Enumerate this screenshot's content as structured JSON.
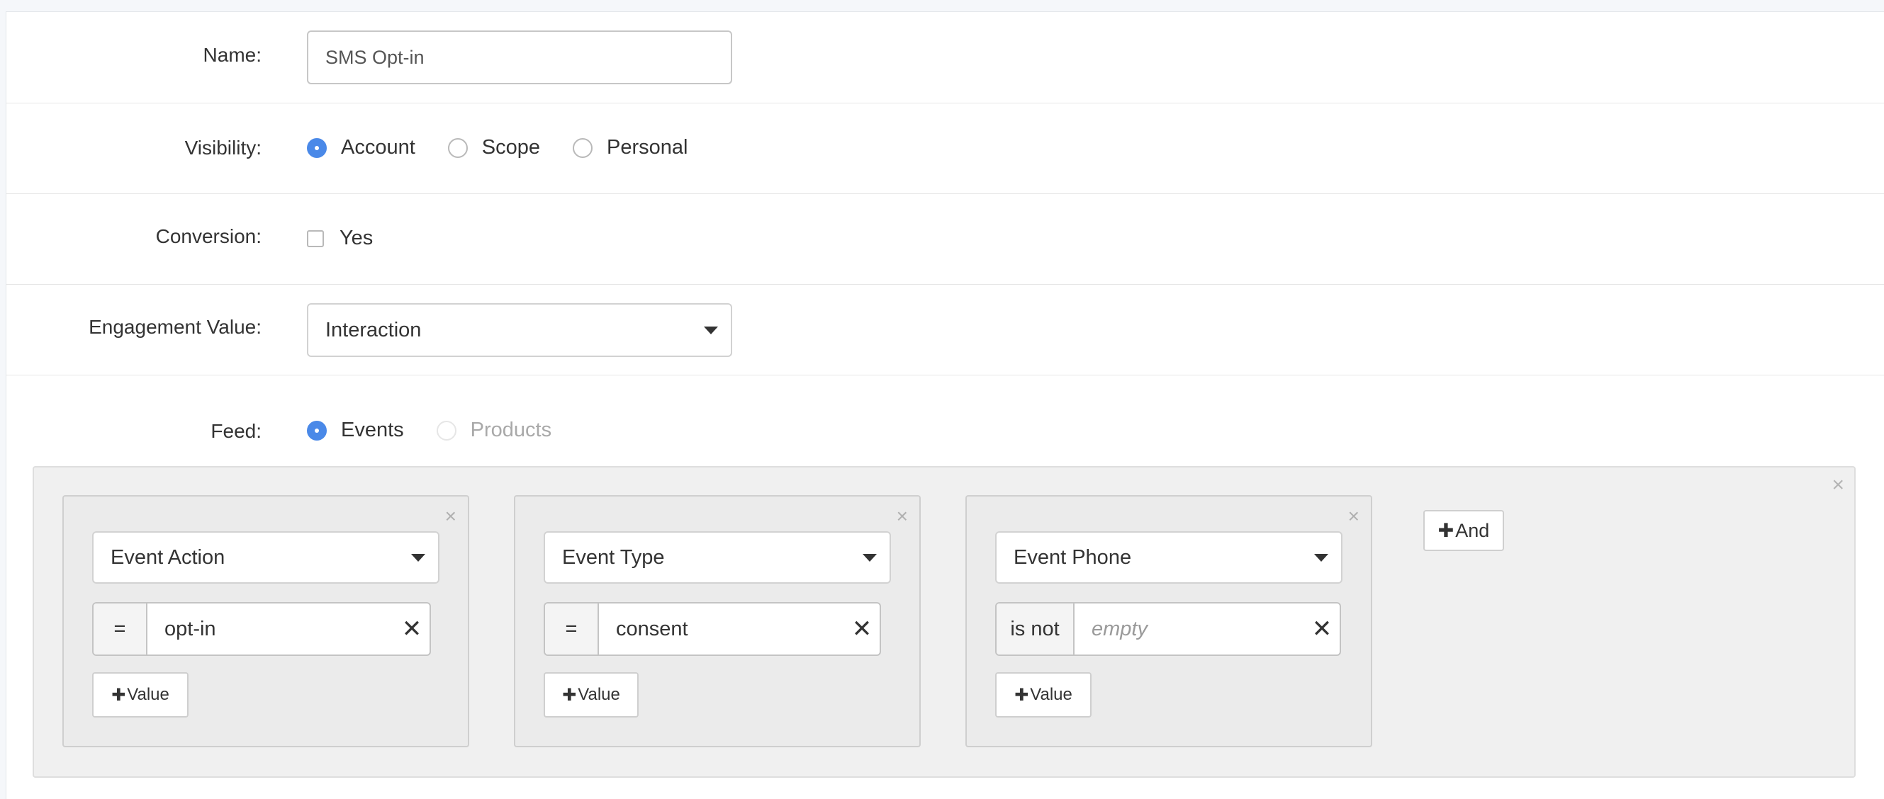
{
  "form": {
    "name": {
      "label": "Name:",
      "value": "SMS Opt-in"
    },
    "visibility": {
      "label": "Visibility:",
      "options": [
        {
          "label": "Account",
          "selected": true
        },
        {
          "label": "Scope",
          "selected": false
        },
        {
          "label": "Personal",
          "selected": false
        }
      ]
    },
    "conversion": {
      "label": "Conversion:",
      "checkbox_label": "Yes",
      "checked": false
    },
    "engagement": {
      "label": "Engagement Value:",
      "selected": "Interaction"
    },
    "feed": {
      "label": "Feed:",
      "options": [
        {
          "label": "Events",
          "selected": true,
          "disabled": false
        },
        {
          "label": "Products",
          "selected": false,
          "disabled": true
        }
      ]
    }
  },
  "builder": {
    "close_symbol": "×",
    "and_button": {
      "plus": "✚",
      "label": "And"
    },
    "conditions": [
      {
        "field": "Event Action",
        "operator": "=",
        "value": "opt-in",
        "placeholder": "",
        "add_value": "Value"
      },
      {
        "field": "Event Type",
        "operator": "=",
        "value": "consent",
        "placeholder": "",
        "add_value": "Value"
      },
      {
        "field": "Event Phone",
        "operator": "is not",
        "value": "",
        "placeholder": "empty",
        "add_value": "Value"
      }
    ],
    "clear_symbol": "✕",
    "plus_symbol": "✚"
  },
  "colors": {
    "accent": "#4a89e8",
    "panel": "#f0f0f0",
    "card": "#ebebeb"
  }
}
